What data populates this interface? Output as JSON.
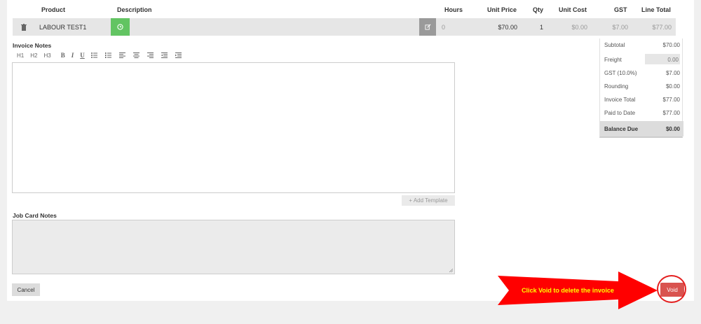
{
  "columns": {
    "product": "Product",
    "description": "Description",
    "hours": "Hours",
    "unit_price": "Unit Price",
    "qty": "Qty",
    "unit_cost": "Unit Cost",
    "gst": "GST",
    "line_total": "Line Total"
  },
  "line": {
    "product": "LABOUR TEST1",
    "hours": "0",
    "unit_price": "$70.00",
    "qty": "1",
    "unit_cost": "$0.00",
    "gst": "$7.00",
    "line_total": "$77.00"
  },
  "invoice_notes": {
    "label": "Invoice Notes",
    "toolbar": [
      "H1",
      "H2",
      "H3",
      "B",
      "I",
      "U"
    ],
    "add_template": "+ Add Template"
  },
  "job_card_notes": {
    "label": "Job Card Notes"
  },
  "cancel_label": "Cancel",
  "totals": {
    "subtotal_label": "Subtotal",
    "subtotal": "$70.00",
    "freight_label": "Freight",
    "freight": "0.00",
    "gst_label": "GST (10.0%)",
    "gst": "$7.00",
    "rounding_label": "Rounding",
    "rounding": "$0.00",
    "invoice_total_label": "Invoice Total",
    "invoice_total": "$77.00",
    "paid_label": "Paid to Date",
    "paid": "$77.00",
    "balance_label": "Balance Due",
    "balance": "$0.00"
  },
  "callout": "Click Void to delete the invoice",
  "void_label": "Void",
  "colors": {
    "green": "#62c462",
    "red": "#ff0000",
    "void": "#d9534f",
    "callout_text": "#ffff00"
  }
}
